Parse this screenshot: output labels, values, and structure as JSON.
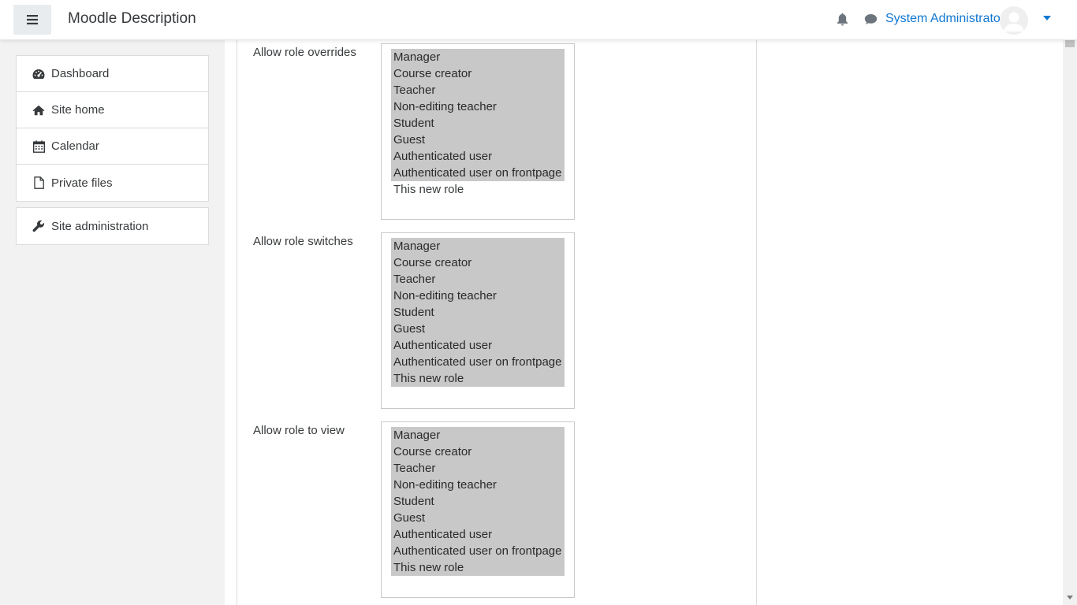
{
  "navbar": {
    "title": "Moodle Description",
    "menu_icon": "hamburger-icon",
    "notification_icon": "bell-icon",
    "messages_icon": "chat-icon",
    "user_name": "System Administrator",
    "accent": "#1177d1"
  },
  "sidebar": {
    "items": [
      {
        "label": "Dashboard",
        "icon": "dashboard-icon"
      },
      {
        "label": "Site home",
        "icon": "home-icon"
      },
      {
        "label": "Calendar",
        "icon": "calendar-icon"
      },
      {
        "label": "Private files",
        "icon": "file-icon"
      }
    ],
    "admin": {
      "label": "Site administration",
      "icon": "wrench-icon"
    }
  },
  "fields": [
    {
      "label": "Allow role overrides",
      "options": [
        "Manager",
        "Course creator",
        "Teacher",
        "Non-editing teacher",
        "Student",
        "Guest",
        "Authenticated user",
        "Authenticated user on frontpage",
        "This new role"
      ],
      "selected": [
        true,
        true,
        true,
        true,
        true,
        true,
        true,
        true,
        false
      ]
    },
    {
      "label": "Allow role switches",
      "options": [
        "Manager",
        "Course creator",
        "Teacher",
        "Non-editing teacher",
        "Student",
        "Guest",
        "Authenticated user",
        "Authenticated user on frontpage",
        "This new role"
      ],
      "selected": [
        true,
        true,
        true,
        true,
        true,
        true,
        true,
        true,
        true
      ]
    },
    {
      "label": "Allow role to view",
      "options": [
        "Manager",
        "Course creator",
        "Teacher",
        "Non-editing teacher",
        "Student",
        "Guest",
        "Authenticated user",
        "Authenticated user on frontpage",
        "This new role"
      ],
      "selected": [
        true,
        true,
        true,
        true,
        true,
        true,
        true,
        true,
        true
      ]
    }
  ]
}
